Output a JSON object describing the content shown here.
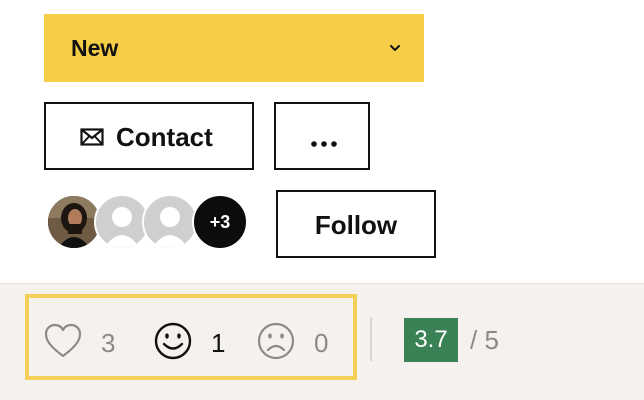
{
  "status_select": {
    "value": "New",
    "icon": "chevron-down-icon"
  },
  "actions": {
    "contact_label": "Contact",
    "contact_icon": "envelope-icon",
    "more_icon": "more-horizontal-icon",
    "follow_label": "Follow"
  },
  "followers": {
    "avatars": [
      "user-photo-avatar",
      "placeholder-avatar",
      "placeholder-avatar"
    ],
    "more_count": "+3"
  },
  "reactions": [
    {
      "icon": "heart-icon",
      "count": "3"
    },
    {
      "icon": "smile-icon",
      "count": "1"
    },
    {
      "icon": "frown-icon",
      "count": "0"
    }
  ],
  "rating": {
    "score": "3.7",
    "max_text": "/ 5"
  },
  "colors": {
    "accent_yellow": "#f6cd47",
    "highlight_border": "#f3cf55",
    "rating_green": "#3a8155",
    "footer_bg": "#f4f1ee"
  }
}
